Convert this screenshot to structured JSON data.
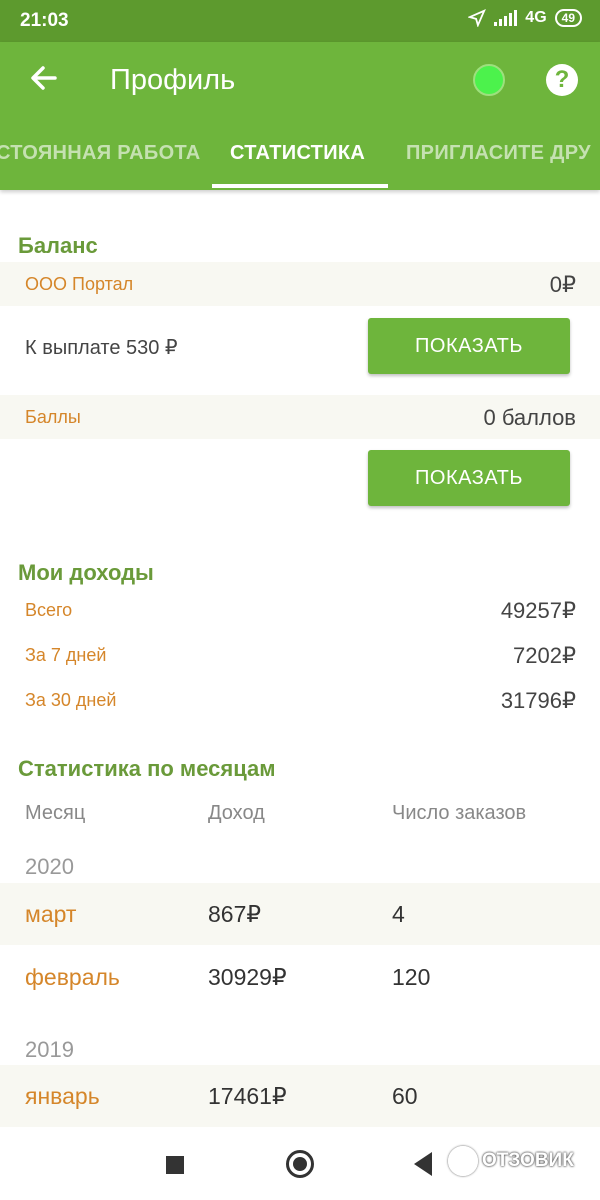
{
  "status": {
    "time": "21:03",
    "network": "4G",
    "battery": "49"
  },
  "appbar": {
    "title": "Профиль",
    "tabs": [
      {
        "label": "СТОЯННАЯ РАБОТА",
        "active": false
      },
      {
        "label": "СТАТИСТИКА",
        "active": true
      },
      {
        "label": "ПРИГЛАСИТЕ ДРУ",
        "active": false
      }
    ]
  },
  "balance": {
    "title": "Баланс",
    "company_label": "ООО Портал",
    "company_value": "0₽",
    "payout_text": "К выплате 530 ₽",
    "show_button": "ПОКАЗАТЬ",
    "points_label": "Баллы",
    "points_value": "0 баллов",
    "show_button2": "ПОКАЗАТЬ"
  },
  "income": {
    "title": "Мои доходы",
    "rows": [
      {
        "label": "Всего",
        "value": "49257₽"
      },
      {
        "label": "За 7 дней",
        "value": "7202₽"
      },
      {
        "label": "За 30 дней",
        "value": "31796₽"
      }
    ]
  },
  "monthly": {
    "title": "Статистика по месяцам",
    "headers": {
      "month": "Месяц",
      "income": "Доход",
      "orders": "Число заказов"
    },
    "years": [
      {
        "year": "2020",
        "months": [
          {
            "name": "март",
            "income": "867₽",
            "orders": "4"
          },
          {
            "name": "февраль",
            "income": "30929₽",
            "orders": "120"
          }
        ]
      },
      {
        "year": "2019",
        "months": [
          {
            "name": "январь",
            "income": "17461₽",
            "orders": "60"
          }
        ]
      }
    ]
  },
  "watermark": "ОТЗОВИК"
}
